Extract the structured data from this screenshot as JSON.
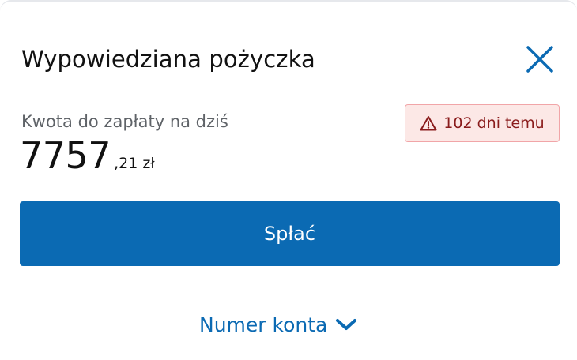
{
  "dialog": {
    "title": "Wypowiedziana pożyczka",
    "close_icon": "close-icon"
  },
  "amount": {
    "label": "Kwota do zapłaty na dziś",
    "integer": "7757",
    "decimal": ",21 zł"
  },
  "overdue_badge": {
    "icon": "warning-icon",
    "text": "102 dni temu",
    "color": "#b3261e"
  },
  "actions": {
    "pay_label": "Spłać",
    "account_toggle_label": "Numer konta",
    "account_toggle_icon": "chevron-down-icon"
  },
  "colors": {
    "accent": "#0b6ab3",
    "badge_bg": "#fce8e6",
    "badge_border": "#f1a5a8"
  }
}
